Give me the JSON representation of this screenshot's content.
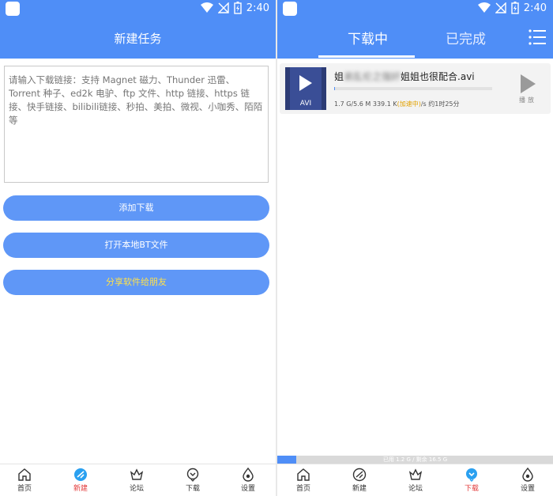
{
  "status": {
    "time": "2:40"
  },
  "left": {
    "title": "新建任务",
    "placeholder": "请输入下载链接：支持 Magnet 磁力、Thunder 迅雷、Torrent 种子、ed2k 电驴、ftp 文件、http 链接、https 链接、快手链接、bilibili链接、秒拍、美拍、微视、小咖秀、陌陌等",
    "buttons": {
      "add": "添加下载",
      "open_bt": "打开本地BT文件",
      "share": "分享软件给朋友"
    },
    "nav": [
      {
        "label": "首页",
        "icon": "home-icon"
      },
      {
        "label": "新建",
        "icon": "new-icon"
      },
      {
        "label": "论坛",
        "icon": "forum-crown-icon"
      },
      {
        "label": "下载",
        "icon": "download-icon"
      },
      {
        "label": "设置",
        "icon": "settings-icon"
      }
    ],
    "active_nav": "新建"
  },
  "right": {
    "tabs": {
      "downloading": "下载中",
      "completed": "已完成"
    },
    "item": {
      "name_prefix": "姐",
      "name_blurred": "弟乱伦之强奸",
      "name_suffix": "姐姐也很配合.avi",
      "thumb_label": "AVI",
      "size": "1.7 G/5.6 M",
      "speed": "339.1 K",
      "state": "(加速中)",
      "eta": "/s 约1时25分",
      "play_label": "播放",
      "progress": 0.003
    },
    "storage": {
      "text": "已用 1.2 G / 剩余 16.5 G",
      "used_fraction": 0.07
    },
    "nav": [
      {
        "label": "首页",
        "icon": "home-icon"
      },
      {
        "label": "新建",
        "icon": "new-icon"
      },
      {
        "label": "论坛",
        "icon": "forum-crown-icon"
      },
      {
        "label": "下载",
        "icon": "download-icon"
      },
      {
        "label": "设置",
        "icon": "settings-icon"
      }
    ],
    "active_nav": "下载"
  },
  "colors": {
    "primary": "#4f8ef7",
    "button": "#5f97f7",
    "share_text": "#ffe14a",
    "active_nav": "#e23a3a",
    "state": "#e2a100"
  }
}
